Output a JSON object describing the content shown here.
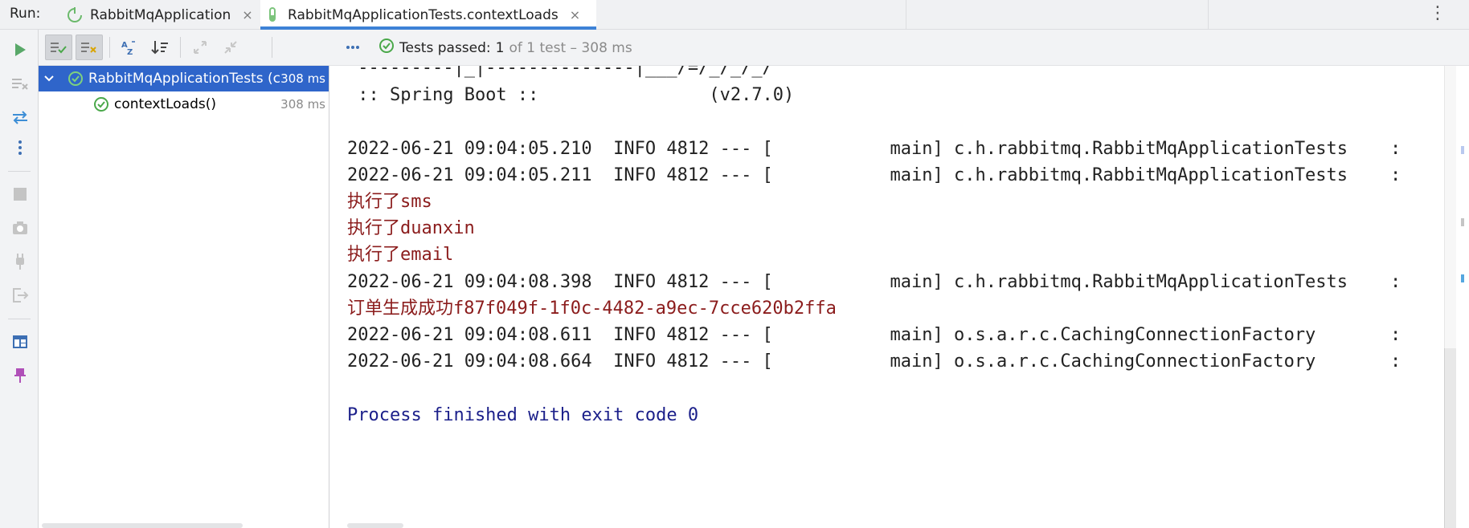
{
  "run_label": "Run:",
  "tabs": [
    {
      "label": "RabbitMqApplication",
      "close": "×"
    },
    {
      "label": "RabbitMqApplicationTests.contextLoads",
      "close": "×"
    }
  ],
  "status": {
    "text": "Tests passed:",
    "count": "1",
    "detail": "of 1 test – 308 ms"
  },
  "tree": {
    "root": {
      "label": "RabbitMqApplicationTests (c",
      "time": "308 ms"
    },
    "child": {
      "label": "contextLoads()",
      "time": "308 ms"
    }
  },
  "console": {
    "banner_partial": " ---------|_|--------------|___/=/_/_/_/",
    "spring_boot": " :: Spring Boot ::                (v2.7.0)",
    "lines": [
      "2022-06-21 09:04:05.210  INFO 4812 --- [           main] c.h.rabbitmq.RabbitMqApplicationTests    :",
      "2022-06-21 09:04:05.211  INFO 4812 --- [           main] c.h.rabbitmq.RabbitMqApplicationTests    :",
      "执行了sms",
      "执行了duanxin",
      "执行了email",
      "2022-06-21 09:04:08.398  INFO 4812 --- [           main] c.h.rabbitmq.RabbitMqApplicationTests    :",
      "订单生成成功f87f049f-1f0c-4482-a9ec-7cce620b2ffa",
      "2022-06-21 09:04:08.611  INFO 4812 --- [           main] o.s.a.r.c.CachingConnectionFactory       :",
      "2022-06-21 09:04:08.664  INFO 4812 --- [           main] o.s.a.r.c.CachingConnectionFactory       :"
    ],
    "exit": "Process finished with exit code 0"
  },
  "colors": {
    "accent": "#3d82d6",
    "selection": "#2f65ca",
    "pass_green": "#4aa84a",
    "run_green": "#59a869",
    "console_red": "#8b1c1c",
    "console_blue": "#1b1f8a"
  }
}
